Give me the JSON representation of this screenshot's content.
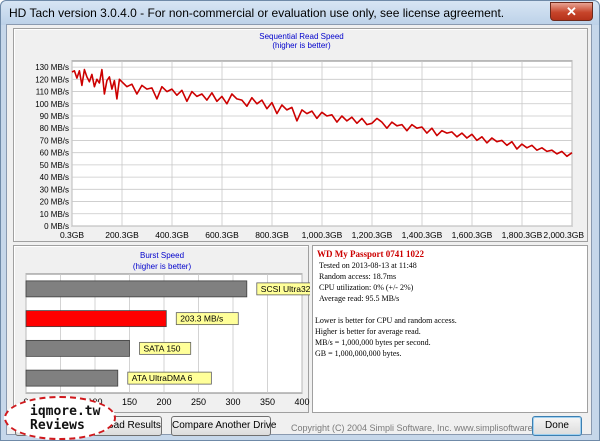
{
  "window": {
    "title": "HD Tach version 3.0.4.0  - For non-commercial or evaluation use only, see license agreement.",
    "close_label": "✕"
  },
  "colors": {
    "read_line": "#cc0000",
    "burst_bar": "#ff0000",
    "ref_bar": "#808080",
    "label_bg": "#ffff99"
  },
  "chart_data": [
    {
      "type": "line",
      "title": "Sequential Read Speed",
      "subtitle": "(higher is better)",
      "xlabel": "",
      "ylabel": "",
      "x_ticks": [
        "0.3GB",
        "200.3GB",
        "400.3GB",
        "600.3GB",
        "800.3GB",
        "1,000.3GB",
        "1,200.3GB",
        "1,400.3GB",
        "1,600.3GB",
        "1,800.3GB",
        "2,000.3GB"
      ],
      "y_ticks": [
        "0 MB/s",
        "10 MB/s",
        "20 MB/s",
        "30 MB/s",
        "40 MB/s",
        "50 MB/s",
        "60 MB/s",
        "70 MB/s",
        "80 MB/s",
        "90 MB/s",
        "100 MB/s",
        "110 MB/s",
        "120 MB/s",
        "130 MB/s"
      ],
      "xlim": [
        0.3,
        2000.3
      ],
      "ylim": [
        0,
        135
      ],
      "grid": true,
      "series": [
        {
          "x": [
            0.3,
            10,
            20,
            30,
            40,
            50,
            60,
            70,
            80,
            90,
            100,
            110,
            120,
            130,
            140,
            150,
            160,
            170,
            180,
            190,
            200,
            220,
            240,
            260,
            280,
            300,
            320,
            340,
            360,
            380,
            400,
            420,
            440,
            460,
            480,
            500,
            520,
            540,
            560,
            580,
            600,
            620,
            640,
            660,
            680,
            700,
            720,
            740,
            760,
            780,
            800,
            820,
            840,
            860,
            880,
            900,
            920,
            940,
            960,
            980,
            1000,
            1020,
            1040,
            1060,
            1080,
            1100,
            1120,
            1140,
            1160,
            1180,
            1200,
            1220,
            1240,
            1260,
            1280,
            1300,
            1320,
            1340,
            1360,
            1380,
            1400,
            1420,
            1440,
            1460,
            1480,
            1500,
            1520,
            1540,
            1560,
            1580,
            1600,
            1620,
            1640,
            1660,
            1680,
            1700,
            1720,
            1740,
            1760,
            1780,
            1800,
            1820,
            1840,
            1860,
            1880,
            1900,
            1920,
            1940,
            1960,
            1980,
            2000.3
          ],
          "y": [
            126,
            127,
            121,
            127,
            115,
            128,
            122,
            118,
            124,
            114,
            120,
            117,
            128,
            108,
            119,
            122,
            112,
            119,
            104,
            120,
            118,
            114,
            116,
            108,
            115,
            112,
            113,
            104,
            114,
            110,
            112,
            107,
            111,
            102,
            110,
            106,
            108,
            103,
            109,
            102,
            106,
            100,
            108,
            104,
            103,
            98,
            105,
            100,
            103,
            96,
            101,
            92,
            99,
            95,
            97,
            86,
            95,
            92,
            94,
            88,
            93,
            90,
            91,
            85,
            90,
            86,
            89,
            84,
            88,
            83,
            84,
            88,
            85,
            80,
            85,
            82,
            83,
            78,
            83,
            80,
            81,
            76,
            80,
            74,
            78,
            76,
            77,
            73,
            76,
            72,
            75,
            70,
            73,
            68,
            72,
            69,
            70,
            66,
            69,
            63,
            67,
            64,
            66,
            62,
            64,
            61,
            62,
            59,
            61,
            57,
            60
          ]
        }
      ]
    },
    {
      "type": "bar",
      "title": "Burst Speed",
      "subtitle": "(higher is better)",
      "xlabel": "",
      "ylabel": "",
      "x_ticks": [
        "0",
        "50",
        "100",
        "150",
        "200",
        "250",
        "300",
        "350",
        "400"
      ],
      "xlim": [
        0,
        400
      ],
      "grid": true,
      "categories": [
        "SCSI Ultra320",
        "203.3 MB/s",
        "SATA 150",
        "ATA UltraDMA 6"
      ],
      "values": [
        320,
        203.3,
        150,
        133
      ],
      "highlight_index": 1
    }
  ],
  "info": {
    "drive_name": "WD My Passport 0741 1022",
    "tested_on": "Tested on 2013-08-13 at 11:48",
    "random_access": "Random access: 18.7ms",
    "cpu": "CPU utilization: 0% (+/- 2%)",
    "average_read": "Average read: 95.5 MB/s",
    "note1": "Lower is better for CPU and random access.",
    "note2": "Higher is better for average read.",
    "note3": "MB/s = 1,000,000 bytes per second.",
    "note4": "GB = 1,000,000,000 bytes."
  },
  "buttons": {
    "save_label": "S",
    "upload_label": "Upload Results",
    "compare_label": "Compare Another Drive",
    "done_label": "Done"
  },
  "footer": {
    "copyright": "Copyright (C) 2004 Simpli Software, Inc. www.simplisoftware.com"
  },
  "watermark": {
    "line1": "iqmore.tw",
    "line2": "Reviews"
  }
}
